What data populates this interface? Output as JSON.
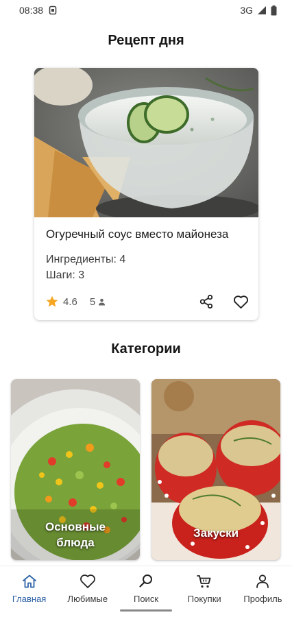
{
  "status_bar": {
    "time": "08:38",
    "network": "3G"
  },
  "recipe_of_day": {
    "section_title": "Рецепт  дня",
    "name": "Огуречный соус вместо майонеза",
    "ingredients": "Ингредиенты: 4",
    "steps": "Шаги: 3",
    "rating": "4.6",
    "reviews": "5"
  },
  "categories": {
    "section_title": "Категории",
    "items": [
      {
        "label": "Основные\nблюда"
      },
      {
        "label": "Закуски"
      }
    ]
  },
  "bottom_nav": {
    "items": [
      {
        "label": "Главная",
        "icon": "home-icon",
        "active": true
      },
      {
        "label": "Любимые",
        "icon": "heart-icon"
      },
      {
        "label": "Поиск",
        "icon": "search-icon"
      },
      {
        "label": "Покупки",
        "icon": "cart-icon"
      },
      {
        "label": "Профиль",
        "icon": "person-icon"
      }
    ]
  },
  "colors": {
    "accent": "#2f63a8",
    "star": "#f5a623"
  }
}
